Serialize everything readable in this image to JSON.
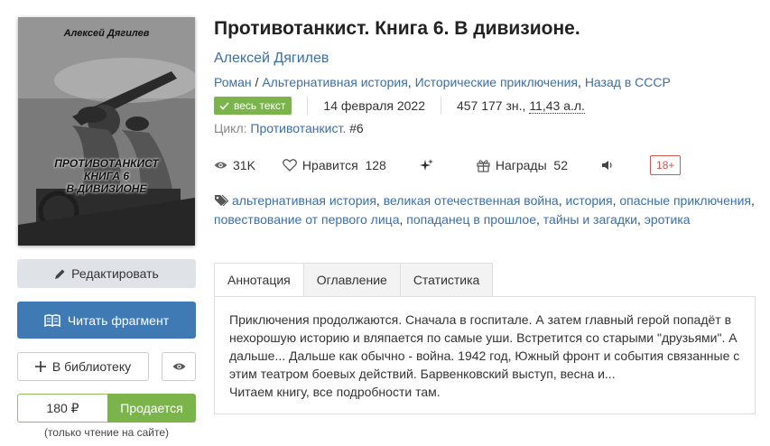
{
  "cover": {
    "author": "Алексей Дягилев",
    "title_line1": "ПРОТИВОТАНКИСТ",
    "title_line2": "КНИГА 6",
    "title_line3": "В ДИВИЗИОНЕ"
  },
  "buttons": {
    "edit": "Редактировать",
    "read": "Читать фрагмент",
    "library": "В библиотеку",
    "price": "180 ₽",
    "sale": "Продается",
    "only_site": "(только чтение на сайте)"
  },
  "book": {
    "title": "Противотанкист. Книга 6. В дивизионе.",
    "author": "Алексей Дягилев",
    "genres": [
      "Роман",
      "Альтернативная история",
      "Исторические приключения",
      "Назад в СССР"
    ],
    "badge": "весь текст",
    "date": "14 февраля 2022",
    "size_chars": "457 177 зн., ",
    "size_al": "11,43 а.л.",
    "cycle_label": "Цикл:",
    "cycle_name": "Противотанкист.",
    "cycle_num": "#6"
  },
  "stats": {
    "views": "31K",
    "likes": "Нравится  128",
    "awards": "Награды  52",
    "age": "18+"
  },
  "tags": [
    "альтернативная история",
    "великая отечественная война",
    "история",
    "опасные приключения",
    "повествование от первого лица",
    "попаданец в прошлое",
    "тайны и загадки",
    "эротика"
  ],
  "tabs": [
    "Аннотация",
    "Оглавление",
    "Статистика"
  ],
  "annotation": {
    "text": "Приключения продолжаются. Сначала в госпитале. А затем главный герой попадёт в нехорошую историю и вляпается по самые уши. Встретится со старыми \"друзьями\". А дальше... Дальше как обычно - война. 1942 год, Южный фронт и события связанные с этим театром боевых действий. Барвенковский выступ, весна и...",
    "line2": "Читаем книгу, все подробности там."
  },
  "colors": {
    "link": "#3a6fa8",
    "primary": "#3f7ab5",
    "green": "#7bb44a",
    "age_red": "#d9534f"
  },
  "icons": [
    "pencil-icon",
    "book-open-icon",
    "plus-icon",
    "eye-icon",
    "check-icon",
    "heart-icon",
    "sparkles-icon",
    "gift-icon",
    "speaker-icon",
    "tag-icon"
  ]
}
